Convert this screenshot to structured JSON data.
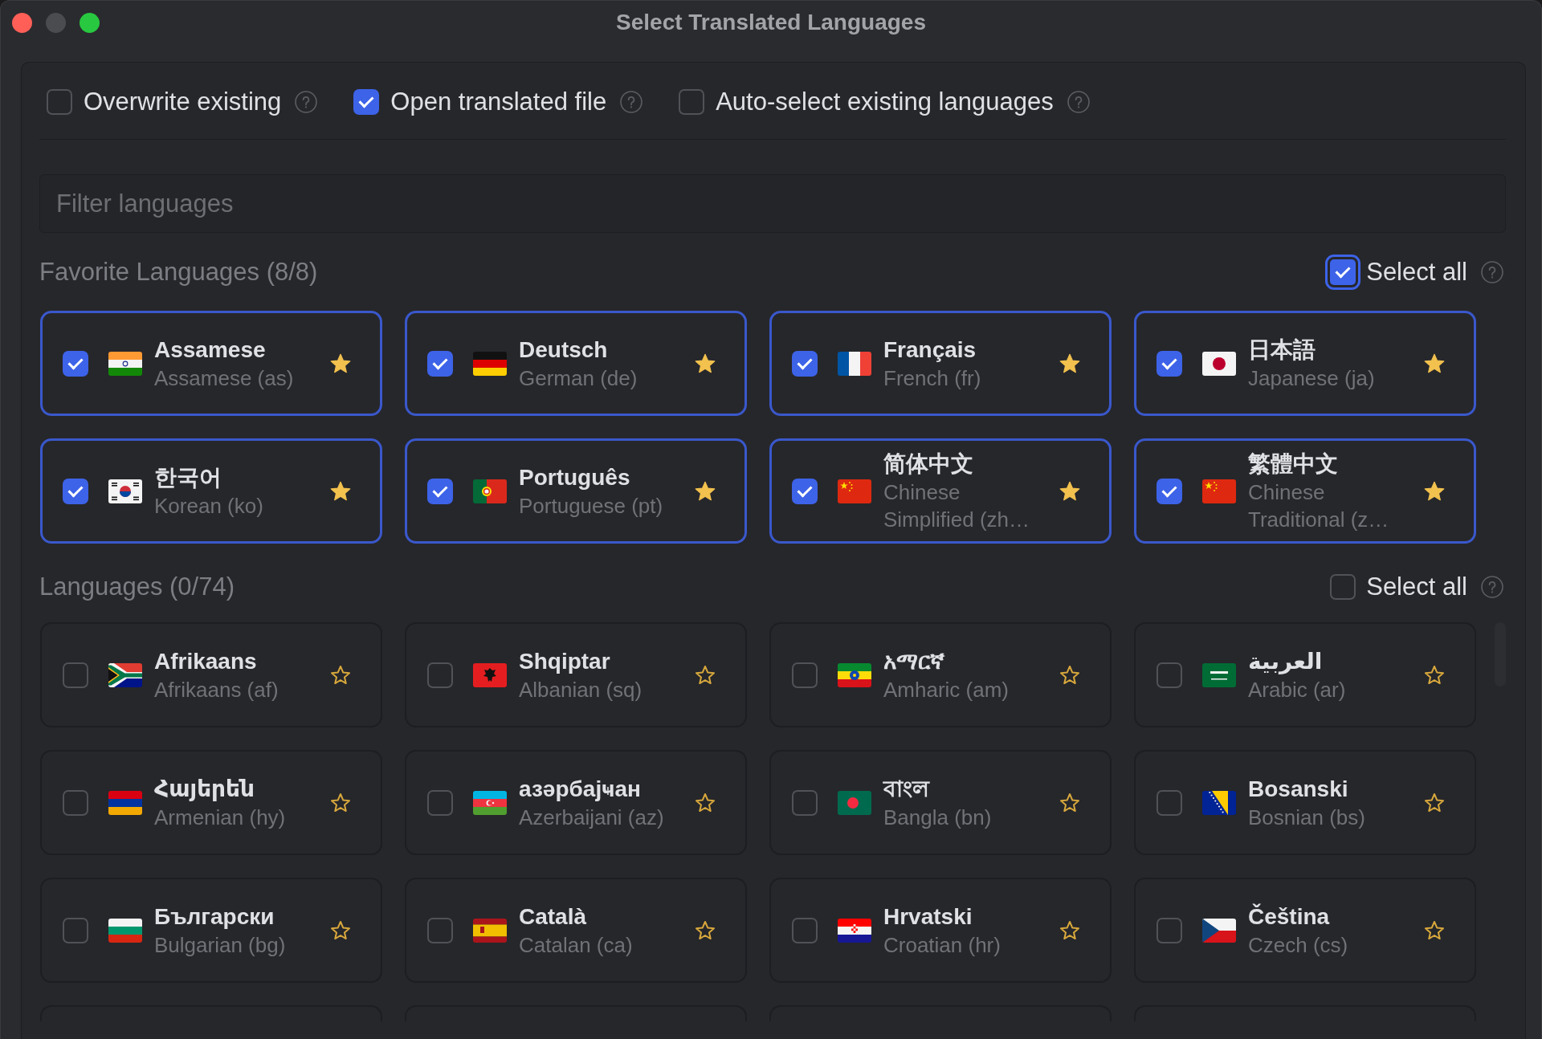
{
  "window": {
    "title": "Select Translated Languages",
    "controls": [
      {
        "kind": "close",
        "disabled": false
      },
      {
        "kind": "minimize",
        "disabled": true
      },
      {
        "kind": "zoom",
        "disabled": false
      }
    ]
  },
  "options": [
    {
      "label": "Overwrite existing",
      "checked": false
    },
    {
      "label": "Open translated file",
      "checked": true
    },
    {
      "label": "Auto-select existing languages",
      "checked": false
    }
  ],
  "filter": {
    "placeholder": "Filter languages"
  },
  "favorites": {
    "title": "Favorite Languages (8/8)",
    "select_all": {
      "label": "Select all",
      "checked": true,
      "focused": true
    },
    "items": [
      {
        "name": "Assamese",
        "subtitle": "Assamese (as)",
        "checked": true,
        "favorite": true
      },
      {
        "name": "Deutsch",
        "subtitle": "German (de)",
        "checked": true,
        "favorite": true
      },
      {
        "name": "Français",
        "subtitle": "French (fr)",
        "checked": true,
        "favorite": true
      },
      {
        "name": "日本語",
        "subtitle": "Japanese (ja)",
        "checked": true,
        "favorite": true
      },
      {
        "name": "한국어",
        "subtitle": "Korean (ko)",
        "checked": true,
        "favorite": true
      },
      {
        "name": "Português",
        "subtitle": "Portuguese (pt)",
        "checked": true,
        "favorite": true
      },
      {
        "name": "简体中文",
        "subtitle": "Chinese Simplified (zh…",
        "checked": true,
        "favorite": true
      },
      {
        "name": "繁體中文",
        "subtitle": "Chinese Traditional (z…",
        "checked": true,
        "favorite": true
      }
    ]
  },
  "languages": {
    "title": "Languages (0/74)",
    "select_all": {
      "label": "Select all",
      "checked": false,
      "focused": false
    },
    "items": [
      {
        "name": "Afrikaans",
        "subtitle": "Afrikaans (af)",
        "checked": false,
        "favorite": false
      },
      {
        "name": "Shqiptar",
        "subtitle": "Albanian (sq)",
        "checked": false,
        "favorite": false
      },
      {
        "name": "አማርኛ",
        "subtitle": "Amharic (am)",
        "checked": false,
        "favorite": false
      },
      {
        "name": "العربية",
        "subtitle": "Arabic (ar)",
        "checked": false,
        "favorite": false
      },
      {
        "name": "Հայերեն",
        "subtitle": "Armenian (hy)",
        "checked": false,
        "favorite": false
      },
      {
        "name": "азәрбајҹан",
        "subtitle": "Azerbaijani (az)",
        "checked": false,
        "favorite": false
      },
      {
        "name": "বাংল",
        "subtitle": "Bangla (bn)",
        "checked": false,
        "favorite": false
      },
      {
        "name": "Bosanski",
        "subtitle": "Bosnian (bs)",
        "checked": false,
        "favorite": false
      },
      {
        "name": "Български",
        "subtitle": "Bulgarian (bg)",
        "checked": false,
        "favorite": false
      },
      {
        "name": "Català",
        "subtitle": "Catalan (ca)",
        "checked": false,
        "favorite": false
      },
      {
        "name": "Hrvatski",
        "subtitle": "Croatian (hr)",
        "checked": false,
        "favorite": false
      },
      {
        "name": "Čeština",
        "subtitle": "Czech (cs)",
        "checked": false,
        "favorite": false
      }
    ]
  }
}
